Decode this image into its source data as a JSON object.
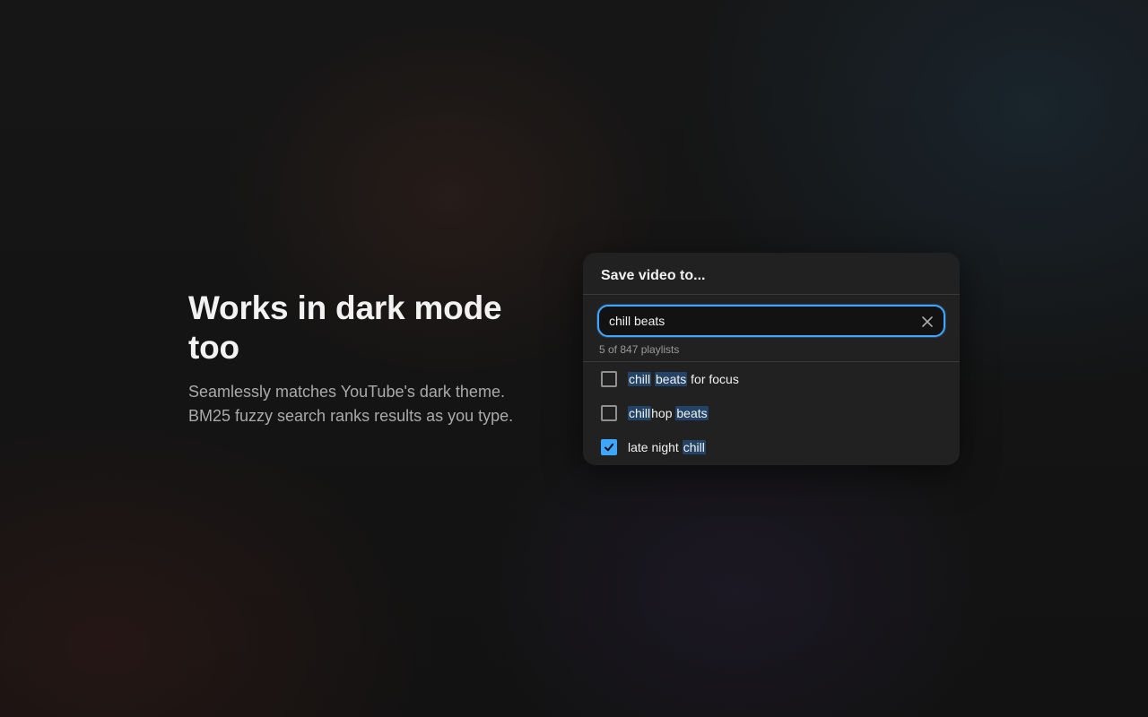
{
  "hero": {
    "title": "Works in dark mode too",
    "line1": "Seamlessly matches YouTube's dark theme.",
    "line2": "BM25 fuzzy search ranks results as you type."
  },
  "dialog": {
    "title": "Save video to...",
    "search_value": "chill beats",
    "result_count": "5 of 847 playlists",
    "accent_color": "#3ea6ff",
    "highlight_color": "#234466",
    "items": [
      {
        "checked": false,
        "parts": [
          {
            "text": "chill",
            "hl": true
          },
          {
            "text": " ",
            "hl": false
          },
          {
            "text": "beats",
            "hl": true
          },
          {
            "text": " for focus",
            "hl": false
          }
        ]
      },
      {
        "checked": false,
        "parts": [
          {
            "text": "chill",
            "hl": true
          },
          {
            "text": "hop ",
            "hl": false
          },
          {
            "text": "beats",
            "hl": true
          }
        ]
      },
      {
        "checked": true,
        "parts": [
          {
            "text": "late night ",
            "hl": false
          },
          {
            "text": "chill",
            "hl": true
          }
        ]
      }
    ]
  }
}
